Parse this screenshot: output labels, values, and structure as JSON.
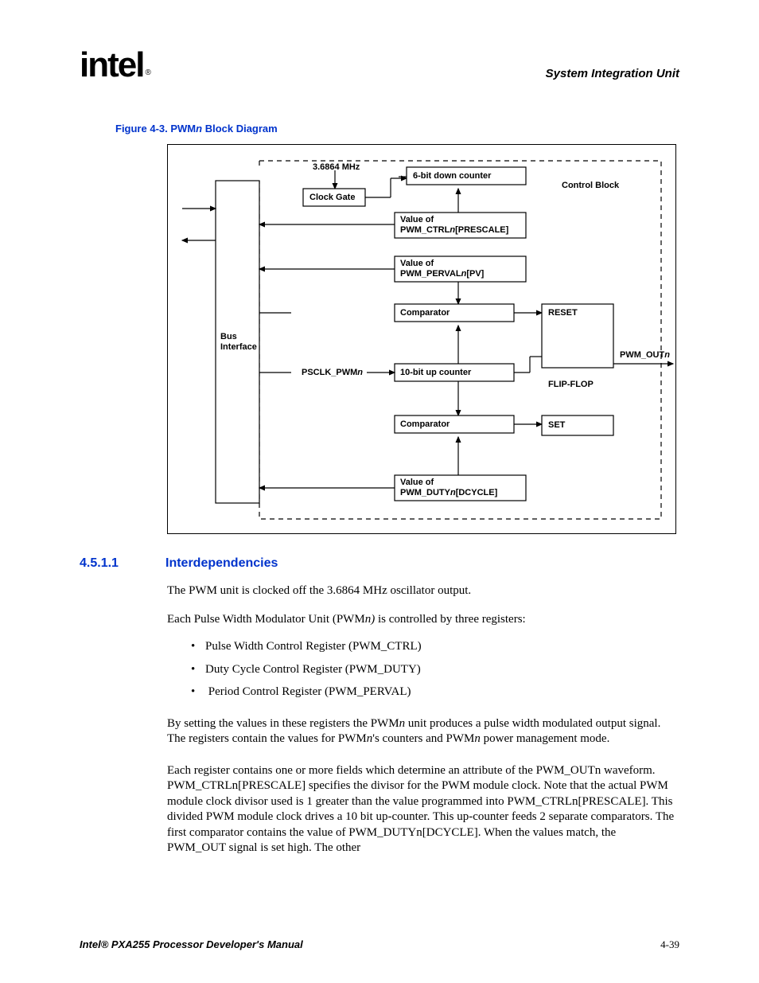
{
  "header": {
    "logo": "intel",
    "logo_reg": "®",
    "title": "System Integration Unit"
  },
  "figure": {
    "caption_prefix": "Figure 4-3. PWM",
    "caption_n": "n",
    "caption_suffix": " Block Diagram"
  },
  "diagram": {
    "clock_freq": "3.6864 MHz",
    "clock_gate": "Clock Gate",
    "down_counter": "6-bit down counter",
    "control_block": "Control Block",
    "bus_interface": "Bus\nInterface",
    "prescale_l1": "Value of",
    "prescale_l2a": "PWM_CTRL",
    "prescale_l2b": "n",
    "prescale_l2c": "[PRESCALE]",
    "perval_l1": "Value of",
    "perval_l2a": "PWM_PERVAL",
    "perval_l2b": "n",
    "perval_l2c": "[PV]",
    "comparator": "Comparator",
    "up_counter": "10-bit up counter",
    "psclk": "PSCLK_PWM",
    "psclk_n": "n",
    "duty_l1": "Value of",
    "duty_l2a": "PWM_DUTY",
    "duty_l2b": "n",
    "duty_l2c": "[DCYCLE]",
    "reset": "RESET",
    "flipflop": "FLIP-FLOP",
    "set": "SET",
    "pwm_out": "PWM_OUT",
    "pwm_out_n": "n"
  },
  "section": {
    "num": "4.5.1.1",
    "title": "Interdependencies",
    "p1": "The PWM unit is clocked off the 3.6864 MHz oscillator output.",
    "p2a": "Each Pulse Width Modulator Unit (PWM",
    "p2n": "n)",
    "p2b": " is controlled by three registers:",
    "li1": "Pulse Width Control Register (PWM_CTRL)",
    "li2": "Duty Cycle Control Register (PWM_DUTY)",
    "li3a": "Period Control Register (PWM_PERVAL",
    "li3b": ")",
    "p3a": "By setting the values in these registers the PWM",
    "p3n1": "n",
    "p3b": " unit produces a pulse width modulated output signal. The registers contain the values for PWM",
    "p3n2": "n",
    "p3c": "'s counters and PWM",
    "p3n3": "n",
    "p3d": " power management mode.",
    "p4": "Each register contains one or more fields which determine an attribute of the PWM_OUTn waveform. PWM_CTRLn[PRESCALE] specifies the divisor for the PWM module clock. Note that the actual PWM module clock divisor used is 1 greater than the value programmed into PWM_CTRLn[PRESCALE]. This divided PWM module clock drives a 10 bit up-counter. This up-counter feeds 2 separate comparators. The first comparator contains the value of PWM_DUTYn[DCYCLE]. When the values match, the PWM_OUT signal is set high. The other"
  },
  "footer": {
    "left": "Intel® PXA255 Processor Developer's Manual",
    "right": "4-39"
  }
}
